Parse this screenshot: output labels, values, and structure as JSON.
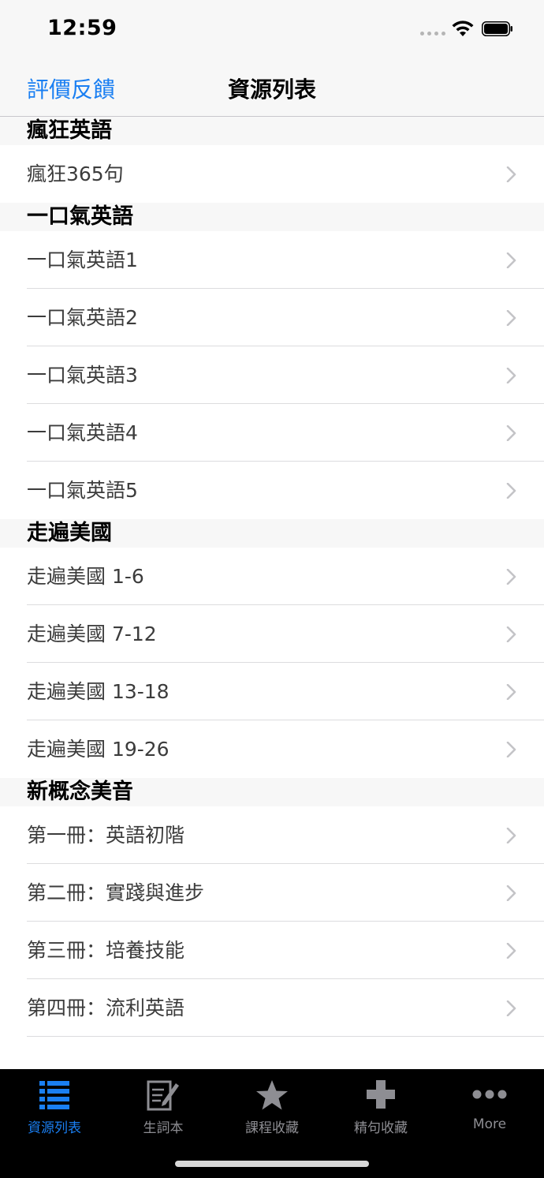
{
  "status_bar": {
    "time": "12:59"
  },
  "nav": {
    "left_button": "評價反饋",
    "title": "資源列表"
  },
  "sections": [
    {
      "header": "瘋狂英語",
      "rows": [
        "瘋狂365句"
      ]
    },
    {
      "header": "一口氣英語",
      "rows": [
        "一口氣英語1",
        "一口氣英語2",
        "一口氣英語3",
        "一口氣英語4",
        "一口氣英語5"
      ]
    },
    {
      "header": "走遍美國",
      "rows": [
        "走遍美國 1-6",
        "走遍美國 7-12",
        "走遍美國 13-18",
        "走遍美國 19-26"
      ]
    },
    {
      "header": "新概念美音",
      "rows": [
        "第一冊：英語初階",
        "第二冊：實踐與進步",
        "第三冊：培養技能",
        "第四冊：流利英語"
      ]
    }
  ],
  "tabbar": {
    "items": [
      {
        "label": "資源列表",
        "icon": "list-icon",
        "active": true
      },
      {
        "label": "生詞本",
        "icon": "notebook-edit-icon",
        "active": false
      },
      {
        "label": "課程收藏",
        "icon": "star-icon",
        "active": false
      },
      {
        "label": "精句收藏",
        "icon": "plus-icon",
        "active": false
      },
      {
        "label": "More",
        "icon": "more-dots-icon",
        "active": false
      }
    ]
  },
  "colors": {
    "accent": "#1a7ff2",
    "tab_inactive": "#8e8e93",
    "tabbar_bg": "#000000",
    "header_bg": "#f7f7f7"
  }
}
